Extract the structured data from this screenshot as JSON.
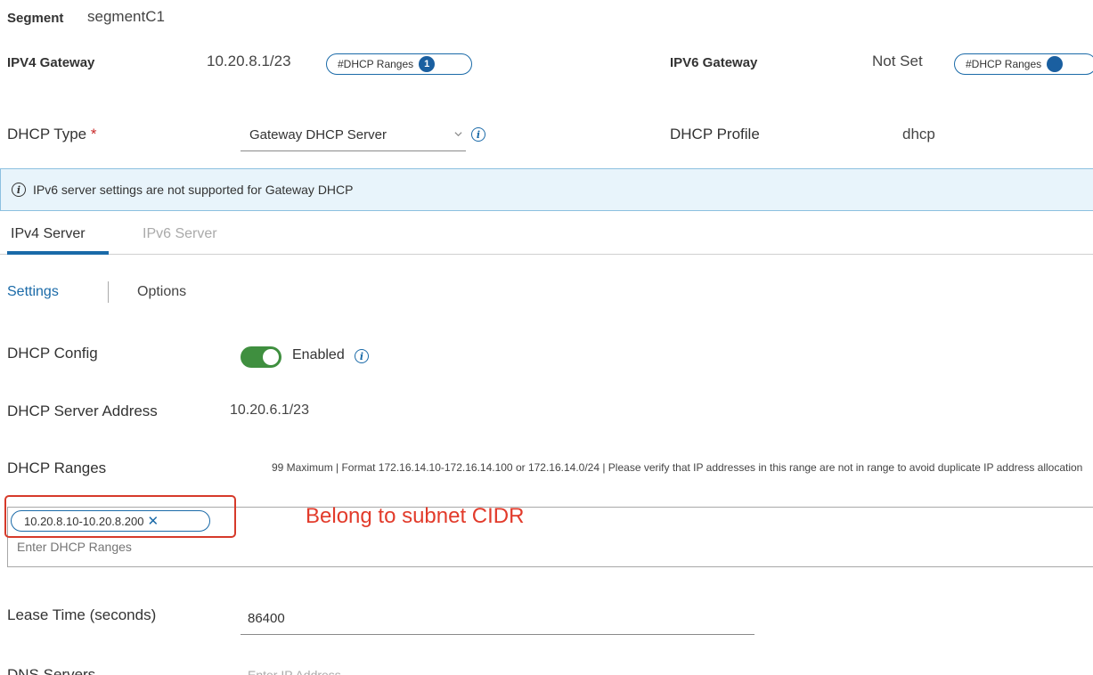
{
  "segment": {
    "label": "Segment",
    "value": "segmentC1"
  },
  "ipv4": {
    "label": "IPV4 Gateway",
    "value": "10.20.8.1/23",
    "pill_label": "#DHCP Ranges",
    "pill_count": "1"
  },
  "ipv6": {
    "label": "IPV6 Gateway",
    "value": "Not Set",
    "pill_label": "#DHCP Ranges"
  },
  "dhcp_type": {
    "label": "DHCP Type",
    "required_mark": "*",
    "value": "Gateway DHCP Server"
  },
  "dhcp_profile": {
    "label": "DHCP Profile",
    "value": "dhcp"
  },
  "banner": {
    "text": "IPv6 server settings are not supported for Gateway DHCP"
  },
  "tabs": [
    {
      "label": "IPv4 Server"
    },
    {
      "label": "IPv6 Server"
    }
  ],
  "subtabs": [
    {
      "label": "Settings"
    },
    {
      "label": "Options"
    }
  ],
  "dhcp_config": {
    "label": "DHCP Config",
    "toggle_label": "Enabled"
  },
  "server_address": {
    "label": "DHCP Server Address",
    "value": "10.20.6.1/23"
  },
  "dhcp_ranges": {
    "label": "DHCP Ranges",
    "hint": "99 Maximum | Format 172.16.14.10-172.16.14.100 or 172.16.14.0/24 | Please verify that IP addresses in this range are not in range to avoid duplicate IP address allocation",
    "chips": [
      "10.20.8.10-10.20.8.200"
    ],
    "placeholder": "Enter DHCP Ranges",
    "annotation": "Belong to subnet CIDR"
  },
  "lease_time": {
    "label": "Lease Time (seconds)",
    "value": "86400"
  },
  "dns_servers": {
    "label": "DNS Servers",
    "placeholder": "Enter IP Address"
  },
  "colors": {
    "accent": "#1a6aa8",
    "toggle_on": "#3f8f3f",
    "annotation": "#e23b2b",
    "banner_bg": "#e8f4fb"
  }
}
